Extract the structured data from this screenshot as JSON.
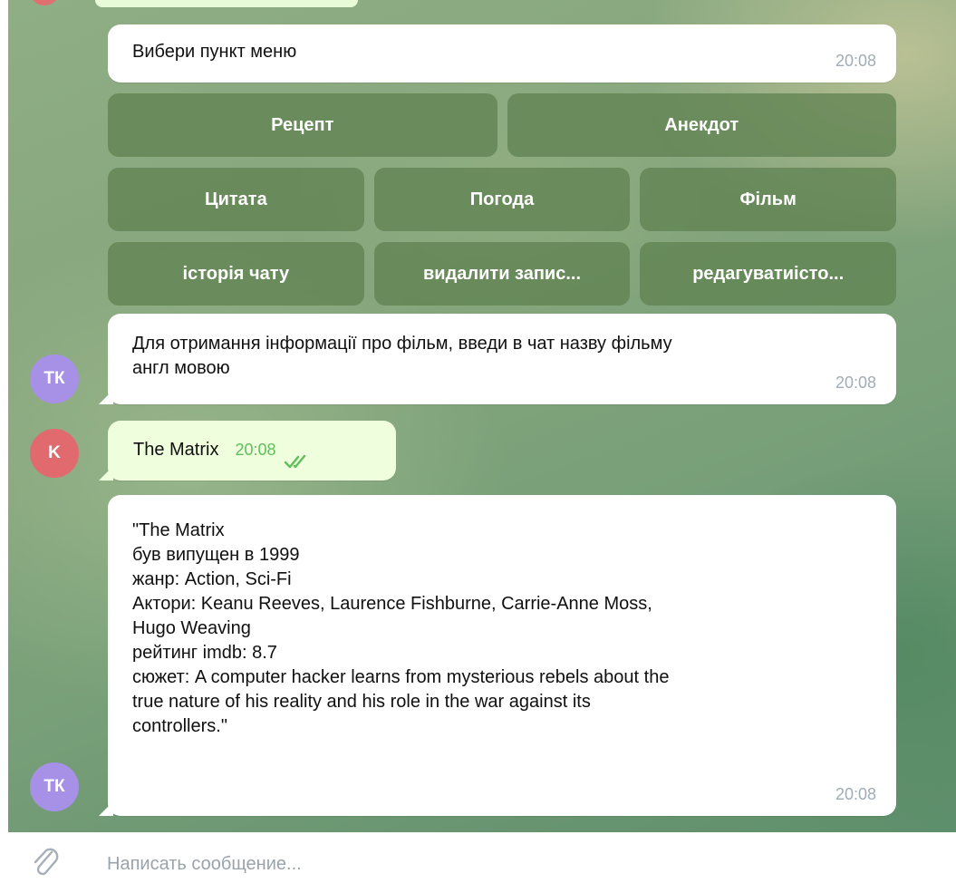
{
  "chat": {
    "menu_prompt": {
      "text": "Вибери пункт меню",
      "time": "20:08"
    },
    "keyboard": {
      "row1": [
        "Рецепт",
        "Анекдот"
      ],
      "row2": [
        "Цитата",
        "Погода",
        "Фільм"
      ],
      "row3": [
        "історія чату",
        "видалити запис...",
        "редагуватиісто..."
      ]
    },
    "film_prompt": {
      "text": "Для отримання інформації про фільм, введи в чат назву фільму\nангл мовою",
      "time": "20:08",
      "avatar": "ТК"
    },
    "user_message": {
      "text": "The Matrix",
      "time": "20:08",
      "avatar": "K"
    },
    "film_info": {
      "text": "\"The Matrix\nбув випущен в 1999\nжанр: Action, Sci-Fi\nАктори: Keanu Reeves, Laurence Fishburne, Carrie-Anne Moss,\nHugo Weaving\nрейтинг imdb: 8.7\nсюжет: A computer hacker learns from mysterious rebels about the\ntrue nature of his reality and his role in the war against its\ncontrollers.\"",
      "time": "20:08",
      "avatar": "ТК"
    }
  },
  "composer": {
    "placeholder": "Написать сообщение...",
    "attach_icon": "paperclip-icon"
  },
  "colors": {
    "bot_avatar": "#a691e6",
    "user_avatar": "#e06a6e",
    "outgoing_bubble": "#effedd",
    "read_check": "#5fbf5b",
    "keyboard_button": "#6f8f60"
  }
}
